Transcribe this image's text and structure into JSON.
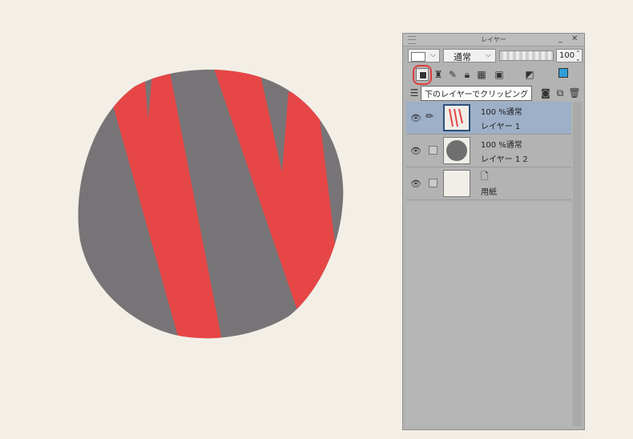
{
  "colors": {
    "background": "#f3efe6",
    "circle_gray": "#777477",
    "stripe_red": "#e64646",
    "selected_row": "#9db0c7"
  },
  "panel": {
    "title": "レイヤー",
    "minimize": "_",
    "close": "✕",
    "blend_mode": "通常",
    "opacity_value": "100",
    "tooltip": "下のレイヤーでクリッピング"
  },
  "layers": [
    {
      "opacity_mode": "100 %通常",
      "name": "レイヤー 1",
      "selected": true,
      "thumb": "red-stripes"
    },
    {
      "opacity_mode": "100 %通常",
      "name": "レイヤー 1 2",
      "selected": false,
      "thumb": "gray-circle"
    },
    {
      "opacity_mode": "",
      "name": "用紙",
      "selected": false,
      "thumb": "paper"
    }
  ],
  "icons": {
    "eye": "eye-icon",
    "pen": "pen-icon",
    "clip": "clip-to-below-icon",
    "ref": "reference-layer-icon",
    "lock": "lock-icon",
    "trash": "trash-icon"
  }
}
